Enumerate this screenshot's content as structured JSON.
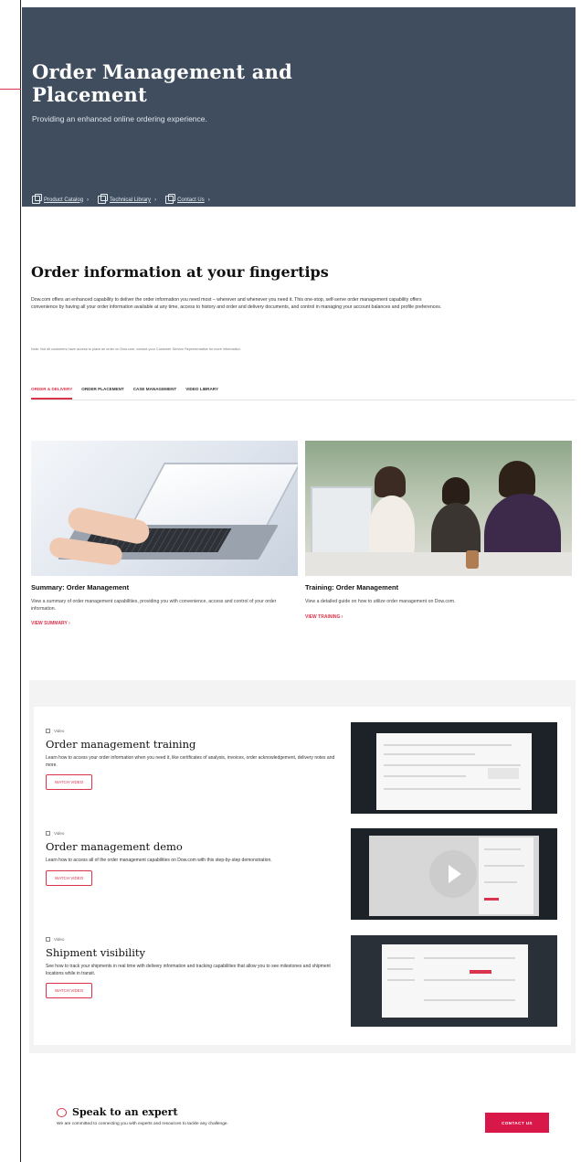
{
  "hero": {
    "title": "Order Management and Placement",
    "subtitle": "Providing an enhanced online ordering experience.",
    "links": [
      {
        "label": "Product Catalog",
        "icon": "copy-icon"
      },
      {
        "label": "Technical Library",
        "icon": "copy-icon"
      },
      {
        "label": "Contact Us",
        "icon": "copy-icon"
      }
    ],
    "background": "#3f4d5e"
  },
  "section": {
    "title": "Order information at your fingertips",
    "intro": "Dow.com offers an enhanced capability to deliver the order information you need most – wherever and whenever you need it. This one-stop, self-serve order management capability offers convenience by having all your order information available at any time, access to history and order and delivery documents, and control in managing your account balances and profile preferences.",
    "note": "Note: Not all customers have access to place an order on Dow.com; contact your Customer Service Representative for more information."
  },
  "tabs": [
    {
      "label": "ORDER & DELIVERY",
      "active": true
    },
    {
      "label": "ORDER PLACEMENT",
      "active": false
    },
    {
      "label": "CASE MANAGEMENT",
      "active": false
    },
    {
      "label": "VIDEO LIBRARY",
      "active": false
    }
  ],
  "cards": [
    {
      "title": "Summary: Order Management",
      "text": "View a summary of order management capabilities, providing you with convenience, access and control of your order information.",
      "link": "VIEW SUMMARY ›"
    },
    {
      "title": "Training: Order Management",
      "text": "View a detailed guide on how to utilize order management on Dow.com.",
      "link": "VIEW TRAINING ›"
    }
  ],
  "videos": [
    {
      "tag": "Video",
      "title": "Order management training",
      "text": "Learn how to access your order information when you need it, like certificates of analysis, invoices, order acknowledgement, delivery notes and more.",
      "button": "WATCH VIDEO"
    },
    {
      "tag": "Video",
      "title": "Order management demo",
      "text": "Learn how to access all of the order management capabilities on Dow.com with this step-by-step demonstration.",
      "button": "WATCH VIDEO"
    },
    {
      "tag": "Video",
      "title": "Shipment visibility",
      "text": "See how to track your shipments in real time with delivery information and tracking capabilities that allow you to see milestones and shipment locations while in transit.",
      "button": "WATCH VIDEO"
    }
  ],
  "expert": {
    "title": "Speak to an expert",
    "text": "We are committed to connecting you with experts and resources to tackle any challenge.",
    "button": "CONTACT US"
  },
  "colors": {
    "accent": "#d9344b",
    "button": "#d9184a",
    "hero": "#3f4d5e"
  }
}
